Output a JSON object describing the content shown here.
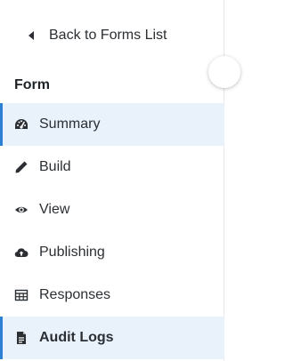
{
  "sidebar": {
    "back_label": "Back to Forms List",
    "section_title": "Form",
    "items": [
      {
        "label": "Summary",
        "icon": "dashboard-icon",
        "active": true
      },
      {
        "label": "Build",
        "icon": "pencil-icon",
        "active": false
      },
      {
        "label": "View",
        "icon": "eye-icon",
        "active": false
      },
      {
        "label": "Publishing",
        "icon": "cloud-upload-icon",
        "active": false
      },
      {
        "label": "Responses",
        "icon": "table-icon",
        "active": false
      },
      {
        "label": "Audit Logs",
        "icon": "file-icon",
        "active": true
      }
    ]
  },
  "colors": {
    "active_bg": "#e9f1fb",
    "active_bar": "#2d7fd3",
    "text": "#2b2f33"
  }
}
